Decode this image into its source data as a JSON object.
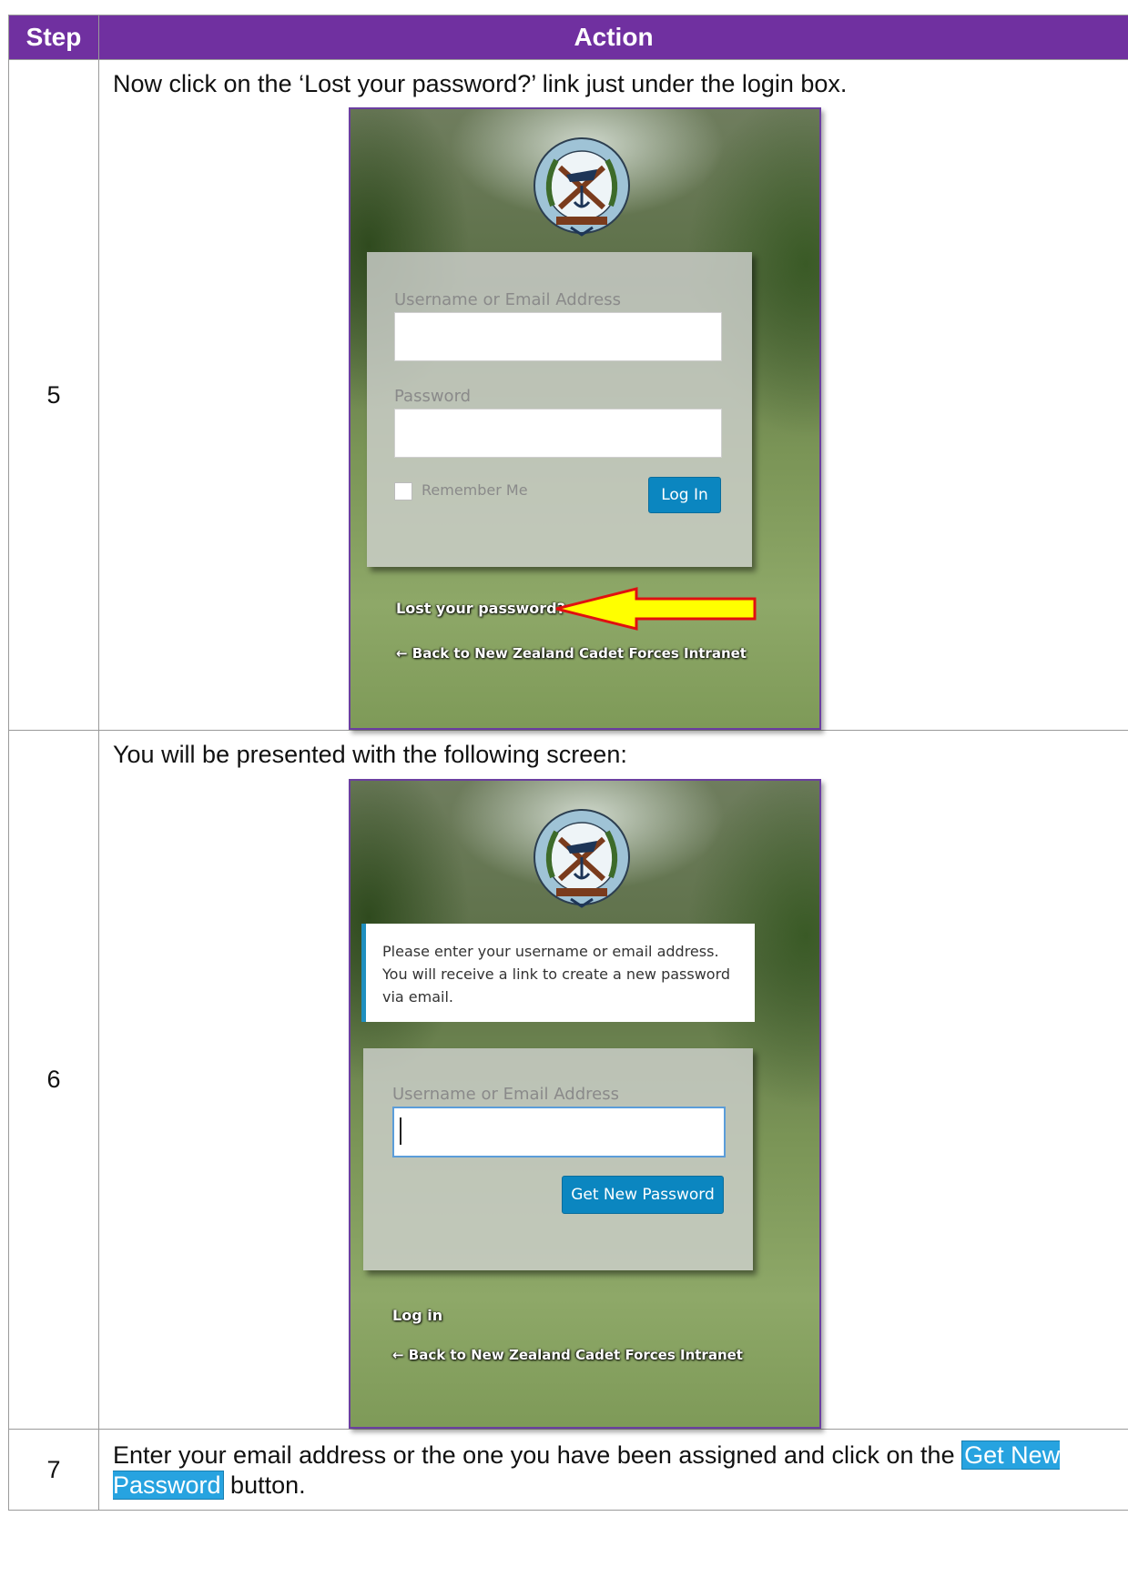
{
  "table": {
    "headers": {
      "step": "Step",
      "action": "Action"
    },
    "rows": [
      {
        "step": "5",
        "instruction": "Now click on the ‘Lost your password?’ link just under the login box."
      },
      {
        "step": "6",
        "instruction": "You will be presented with the following screen:"
      },
      {
        "step": "7",
        "instruction_before": "Enter your email address or the one you have been assigned and click on the ",
        "button_ref": "Get New Password",
        "instruction_after": " button."
      }
    ]
  },
  "login_screen": {
    "username_label": "Username or Email Address",
    "password_label": "Password",
    "remember_me": "Remember Me",
    "login_button": "Log In",
    "lost_password_link": "Lost your password?",
    "back_link": "← Back to New Zealand Cadet Forces Intranet"
  },
  "reset_screen": {
    "notice": "Please enter your username or email address. You will receive a link to create a new password via email.",
    "username_label": "Username or Email Address",
    "get_password_button": "Get New Password",
    "login_link": "Log in",
    "back_link": "← Back to New Zealand Cadet Forces Intranet"
  },
  "colors": {
    "header": "#7030a0",
    "wp_blue": "#0b86c0",
    "arrow_fill": "#ffff00",
    "arrow_stroke": "#e01010"
  },
  "icons": [
    "nz-cadet-forces-emblem-icon",
    "arrow-pointer-icon"
  ]
}
